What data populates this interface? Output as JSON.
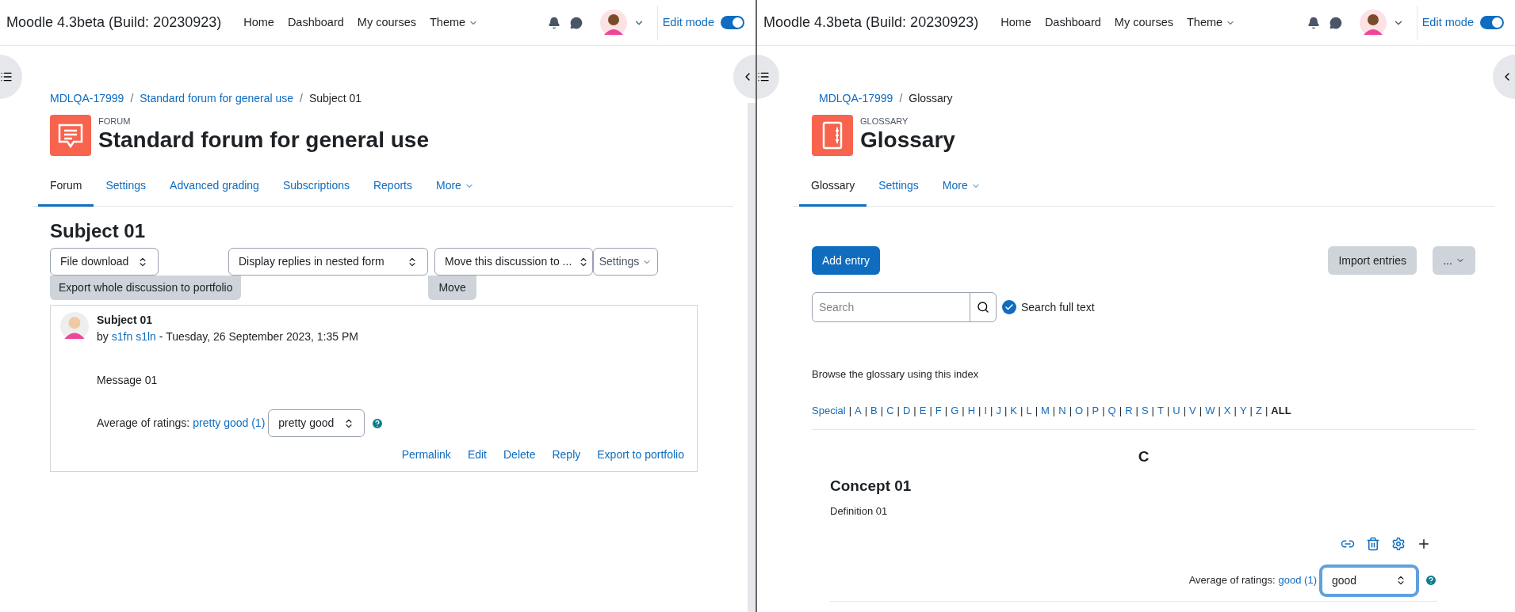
{
  "left_window": {
    "header": {
      "brand": "Moodle 4.3beta (Build: 20230923)",
      "nav": [
        {
          "label": "Home",
          "dropdown": false
        },
        {
          "label": "Dashboard",
          "dropdown": false
        },
        {
          "label": "My courses",
          "dropdown": false
        },
        {
          "label": "Theme",
          "dropdown": true
        }
      ],
      "edit_mode": {
        "label": "Edit mode",
        "on": true
      }
    },
    "breadcrumb": [
      "MDLQA-17999",
      "Standard forum for general use",
      "Subject 01"
    ],
    "breadcrumb_separator": "/",
    "page_header": {
      "kind": "forum",
      "type_label": "FORUM",
      "title": "Standard forum for general use"
    },
    "tabs": [
      {
        "label": "Forum",
        "selected": true,
        "dropdown": false
      },
      {
        "label": "Settings",
        "selected": false,
        "dropdown": false
      },
      {
        "label": "Advanced grading",
        "selected": false,
        "dropdown": false
      },
      {
        "label": "Subscriptions",
        "selected": false,
        "dropdown": false
      },
      {
        "label": "Reports",
        "selected": false,
        "dropdown": false
      },
      {
        "label": "More",
        "selected": false,
        "dropdown": true
      }
    ],
    "discussion": {
      "title": "Subject 01",
      "file_download": "File download",
      "display_mode": "Display replies in nested form",
      "move_select": "Move this discussion to ...",
      "settings_menu": "Settings",
      "export_button": "Export whole discussion to portfolio",
      "move_button": "Move",
      "post": {
        "subject": "Subject 01",
        "by": "by",
        "author": "s1fn s1ln",
        "date": "- Tuesday, 26 September 2023, 1:35 PM",
        "message": "Message 01",
        "rating_label": "Average of ratings:",
        "rating_link": "pretty good (1)",
        "rating_select": "pretty good",
        "actions": [
          "Permalink",
          "Edit",
          "Delete",
          "Reply",
          "Export to portfolio"
        ]
      }
    }
  },
  "right_window": {
    "header": {
      "brand": "Moodle 4.3beta (Build: 20230923)",
      "nav": [
        {
          "label": "Home",
          "dropdown": false
        },
        {
          "label": "Dashboard",
          "dropdown": false
        },
        {
          "label": "My courses",
          "dropdown": false
        },
        {
          "label": "Theme",
          "dropdown": true
        }
      ],
      "edit_mode": {
        "label": "Edit mode",
        "on": true
      }
    },
    "breadcrumb": [
      "MDLQA-17999",
      "Glossary"
    ],
    "breadcrumb_separator": "/",
    "page_header": {
      "kind": "glossary",
      "type_label": "GLOSSARY",
      "title": "Glossary"
    },
    "tabs": [
      {
        "label": "Glossary",
        "selected": true,
        "dropdown": false
      },
      {
        "label": "Settings",
        "selected": false,
        "dropdown": false
      },
      {
        "label": "More",
        "selected": false,
        "dropdown": true
      }
    ],
    "glossary": {
      "add_button": "Add entry",
      "import_button": "Import entries",
      "more_button": "...",
      "search": {
        "placeholder": "Search"
      },
      "full_text": {
        "label": "Search full text",
        "checked": true
      },
      "browse_text": "Browse the glossary using this index",
      "index": [
        {
          "label": "Special",
          "selected": false
        },
        {
          "label": "A",
          "selected": false
        },
        {
          "label": "B",
          "selected": false
        },
        {
          "label": "C",
          "selected": false
        },
        {
          "label": "D",
          "selected": false
        },
        {
          "label": "E",
          "selected": false
        },
        {
          "label": "F",
          "selected": false
        },
        {
          "label": "G",
          "selected": false
        },
        {
          "label": "H",
          "selected": false
        },
        {
          "label": "I",
          "selected": false
        },
        {
          "label": "J",
          "selected": false
        },
        {
          "label": "K",
          "selected": false
        },
        {
          "label": "L",
          "selected": false
        },
        {
          "label": "M",
          "selected": false
        },
        {
          "label": "N",
          "selected": false
        },
        {
          "label": "O",
          "selected": false
        },
        {
          "label": "P",
          "selected": false
        },
        {
          "label": "Q",
          "selected": false
        },
        {
          "label": "R",
          "selected": false
        },
        {
          "label": "S",
          "selected": false
        },
        {
          "label": "T",
          "selected": false
        },
        {
          "label": "U",
          "selected": false
        },
        {
          "label": "V",
          "selected": false
        },
        {
          "label": "W",
          "selected": false
        },
        {
          "label": "X",
          "selected": false
        },
        {
          "label": "Y",
          "selected": false
        },
        {
          "label": "Z",
          "selected": false
        },
        {
          "label": "ALL",
          "selected": true
        }
      ],
      "separator": "|",
      "letter": "C",
      "entry": {
        "concept": "Concept 01",
        "definition": "Definition 01",
        "rating_label": "Average of ratings:",
        "rating_link": "good (1)",
        "rating_select": "good",
        "select_focused": true
      }
    }
  }
}
